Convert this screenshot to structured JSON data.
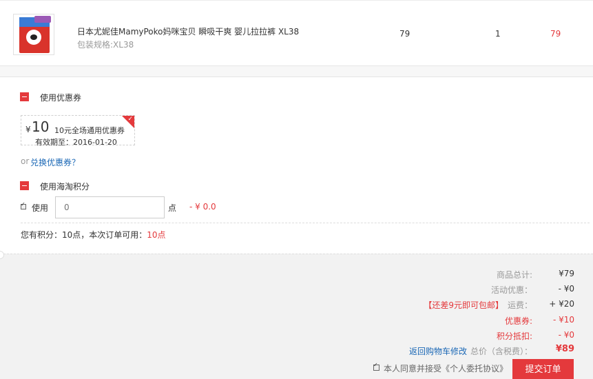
{
  "product": {
    "name": "日本尤妮佳MamyPoko妈咪宝贝 瞬吸干爽 婴儿拉拉裤 XL38",
    "spec": "包装规格:XL38",
    "price": "79",
    "quantity": "1",
    "subtotal": "79"
  },
  "coupon_section": {
    "title": "使用优惠券",
    "coupon": {
      "currency": "¥",
      "amount": "10",
      "description": "10元全场通用优惠券",
      "expiry": "有效期至：2016-01-20"
    },
    "or_text": "or",
    "redeem_link": "兑换优惠券？"
  },
  "points_section": {
    "title": "使用海淘积分",
    "use_label": "使用",
    "input_placeholder": "0",
    "unit": "点",
    "deduction": "- ¥ 0.0",
    "info_prefix": "您有积分：10点，本次订单可用：",
    "info_available": "10点"
  },
  "summary": {
    "goods_total_label": "商品总计:",
    "goods_total_value": "¥79",
    "activity_discount_label": "活动优惠：",
    "activity_discount_value": "- ¥0",
    "free_shipping_hint": "【还差9元即可包邮】",
    "shipping_label": "运费：",
    "shipping_value": "+ ¥20",
    "coupon_label": "优惠券:",
    "coupon_value": "- ¥10",
    "points_label": "积分抵扣:",
    "points_value": "- ¥0",
    "back_link": "返回购物车修改",
    "total_label": "总价（含税费）：",
    "total_value": "¥89",
    "agree_text": "本人同意并接受《个人委托协议》",
    "submit_label": "提交订单"
  },
  "colors": {
    "accent_red": "#e4393c",
    "link_blue": "#1a67b5"
  }
}
